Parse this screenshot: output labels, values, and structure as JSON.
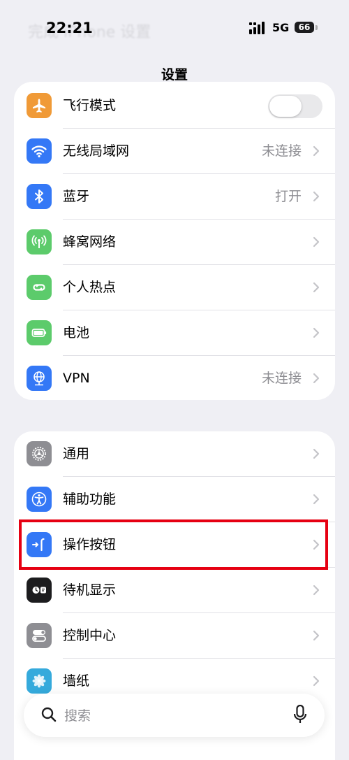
{
  "status_bar": {
    "time": "22:21",
    "network": "5G",
    "battery": "66",
    "ghost_title": "完成  iPhone 设置"
  },
  "header": {
    "title": "设置"
  },
  "group1": [
    {
      "label": "飞行模式",
      "icon": "airplane-icon",
      "color": "#f09a37",
      "type": "toggle",
      "on": false
    },
    {
      "label": "无线局域网",
      "icon": "wifi-icon",
      "color": "#3478f6",
      "value": "未连接"
    },
    {
      "label": "蓝牙",
      "icon": "bluetooth-icon",
      "color": "#3478f6",
      "value": "打开"
    },
    {
      "label": "蜂窝网络",
      "icon": "cellular-icon",
      "color": "#5ccb6b"
    },
    {
      "label": "个人热点",
      "icon": "hotspot-icon",
      "color": "#5ccb6b"
    },
    {
      "label": "电池",
      "icon": "battery-icon",
      "color": "#5ccb6b"
    },
    {
      "label": "VPN",
      "icon": "vpn-icon",
      "color": "#3478f6",
      "value": "未连接"
    }
  ],
  "group2": [
    {
      "label": "通用",
      "icon": "gear-icon",
      "color": "#8e8e93"
    },
    {
      "label": "辅助功能",
      "icon": "accessibility-icon",
      "color": "#3478f6"
    },
    {
      "label": "操作按钮",
      "icon": "action-button-icon",
      "color": "#3478f6",
      "highlighted": true
    },
    {
      "label": "待机显示",
      "icon": "standby-icon",
      "color": "#1c1c1e"
    },
    {
      "label": "控制中心",
      "icon": "control-center-icon",
      "color": "#8e8e93"
    },
    {
      "label": "墙纸",
      "icon": "wallpaper-icon",
      "color": "#35aadc"
    }
  ],
  "search": {
    "placeholder": "搜索"
  },
  "colors": {
    "highlight_border": "#e60012",
    "background": "#efeff4"
  }
}
